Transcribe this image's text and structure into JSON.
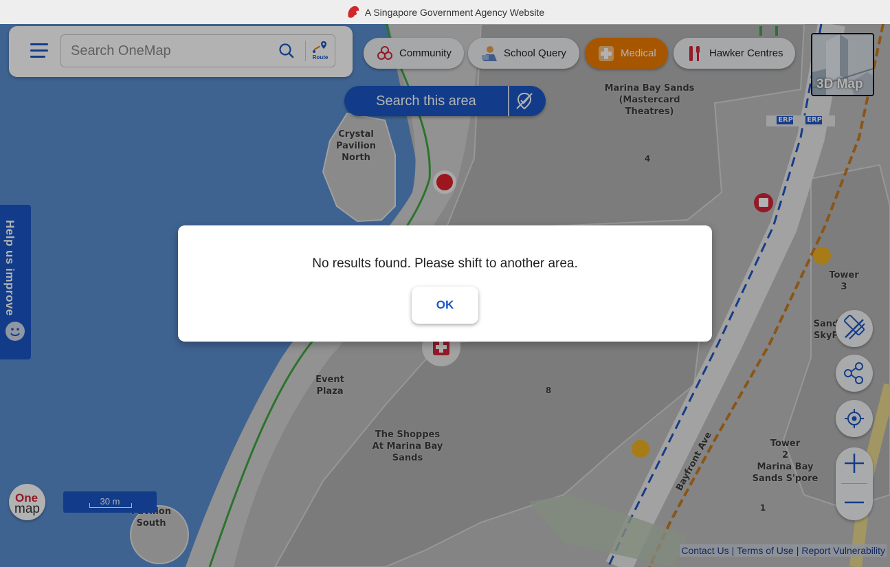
{
  "gov_banner": {
    "text": "A Singapore Government Agency Website"
  },
  "search": {
    "placeholder": "Search OneMap",
    "route_label": "Route"
  },
  "categories": [
    {
      "label": "Community",
      "icon": "community-icon",
      "active": false
    },
    {
      "label": "School Query",
      "icon": "school-icon",
      "active": false
    },
    {
      "label": "Medical",
      "icon": "medical-icon",
      "active": true
    },
    {
      "label": "Hawker Centres",
      "icon": "hawker-icon",
      "active": false
    }
  ],
  "map3d": {
    "label": "3D Map"
  },
  "search_area": {
    "label": "Search this area"
  },
  "feedback": {
    "label": "Help us improve"
  },
  "map_labels": {
    "mbs_theatres": "Marina Bay Sands\n(Mastercard\nTheatres)",
    "crystal_pavilion": "Crystal\nPavilion\nNorth",
    "num_4": "4",
    "tower3": "Tower\n3",
    "sands_skypark": "Sand\nSkyP",
    "event_plaza": "Event\nPlaza",
    "num_8": "8",
    "shoppes": "The Shoppes\nAt Marina Bay\nSands",
    "tower2": "Tower\n2\nMarina Bay\nSands S'pore",
    "bayfront_ave": "Bayfront Ave",
    "num_1": "1",
    "pavilion_south": "al\nPavilion\nSouth",
    "erp": "ERP"
  },
  "scale": {
    "label": "30 m"
  },
  "footer": {
    "links": [
      "Contact Us",
      "Terms of Use",
      "Report Vulnerability"
    ]
  },
  "dialog": {
    "message": "No results found. Please shift to another area.",
    "ok_label": "OK"
  },
  "colors": {
    "primary": "#1a56c4",
    "medical_active": "#ef7c00",
    "water": "#5b8fd0"
  }
}
